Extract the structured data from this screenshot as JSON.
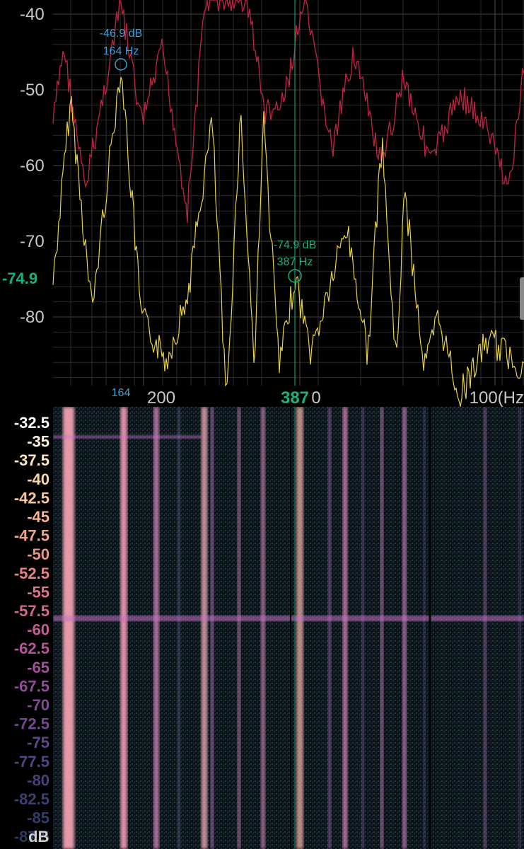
{
  "spectrum": {
    "y_ticks": [
      "-40",
      "-50",
      "-60",
      "-70",
      "-80"
    ],
    "x_ticks": [
      "200",
      "100(Hz"
    ],
    "x_ticks_partial": "387",
    "peak_marker": {
      "db": "-46.9 dB",
      "freq": "164 Hz",
      "axis_freq": "164",
      "color": "#3a9fd8"
    },
    "cursor_marker": {
      "db": "-74.9 dB",
      "freq": "387 Hz",
      "axis_db": "-74.9",
      "axis_freq": "387",
      "color": "#19b27a"
    },
    "series_colors": {
      "current": "#e8d24a",
      "peak_hold": "#b8233f"
    },
    "grid": true
  },
  "spectrogram": {
    "db_scale": [
      "-32.5",
      "-35",
      "-37.5",
      "-40",
      "-42.5",
      "-45",
      "-47.5",
      "-50",
      "-52.5",
      "-55",
      "-57.5",
      "-60",
      "-62.5",
      "-65",
      "-67.5",
      "-70",
      "-72.5",
      "-75",
      "-77.5",
      "-80",
      "-82.5",
      "-85",
      "-87.5"
    ],
    "unit": "dB"
  }
}
